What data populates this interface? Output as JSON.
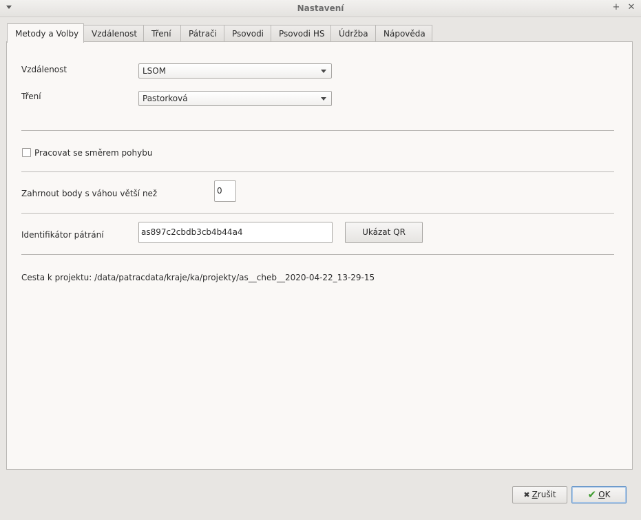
{
  "window": {
    "title": "Nastavení",
    "menu_icon": "chevron-down-icon",
    "maximize_icon": "plus-icon",
    "close_icon": "close-icon"
  },
  "tabs": [
    {
      "label": "Metody a Volby",
      "active": true
    },
    {
      "label": "Vzdálenost",
      "active": false
    },
    {
      "label": "Tření",
      "active": false
    },
    {
      "label": "Pátrači",
      "active": false
    },
    {
      "label": "Psovodi",
      "active": false
    },
    {
      "label": "Psovodi HS",
      "active": false
    },
    {
      "label": "Údržba",
      "active": false
    },
    {
      "label": "Nápověda",
      "active": false
    }
  ],
  "form": {
    "distance_label": "Vzdálenost",
    "distance_value": "LSOM",
    "friction_label": "Tření",
    "friction_value": "Pastorková",
    "direction_checkbox_label": "Pracovat se směrem pohybu",
    "direction_checked": false,
    "weight_label": "Zahrnout body s váhou větší než",
    "weight_value": "0",
    "search_id_label": "Identifikátor pátrání",
    "search_id_value": "as897c2cbdb3cb4b44a4",
    "show_qr_label": "Ukázat QR",
    "project_path": "Cesta k projektu: /data/patracdata/kraje/ka/projekty/as__cheb__2020-04-22_13-29-15"
  },
  "footer": {
    "cancel_mnemonic": "Z",
    "cancel_rest": "rušit",
    "ok_mnemonic": "O",
    "ok_rest": "K"
  }
}
